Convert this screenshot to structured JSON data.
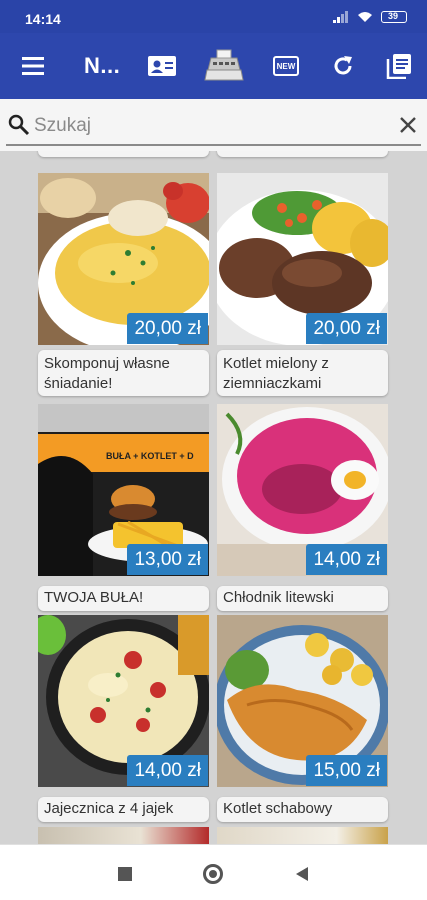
{
  "status": {
    "time": "14:14",
    "battery": "39"
  },
  "toolbar": {
    "title": "N...",
    "icons": [
      "menu-icon",
      "contact-card-icon",
      "cash-register-icon",
      "new-badge-icon",
      "refresh-icon",
      "copy-list-icon"
    ],
    "new_badge": "NEW"
  },
  "search": {
    "placeholder": "Szukaj",
    "value": ""
  },
  "products": [
    {
      "name": "Skomponuj własne śniadanie!",
      "price": "20,00 zł"
    },
    {
      "name": "Kotlet mielony z ziemniaczkami",
      "price": "20,00 zł"
    },
    {
      "name": "TWOJA BUŁA!",
      "price": "13,00 zł",
      "photo_text": "BUŁA + KOTLET + D"
    },
    {
      "name": "Chłodnik litewski",
      "price": "14,00 zł"
    },
    {
      "name": "Jajecznica z 4 jajek",
      "price": "14,00 zł"
    },
    {
      "name": "Kotlet schabowy",
      "price": "15,00 zł"
    }
  ],
  "navbar": {
    "buttons": [
      "recent-apps",
      "home",
      "back"
    ]
  },
  "colors": {
    "appbar": "#2d47ad",
    "price_badge": "#2a7ec0",
    "background": "#d3d3d3"
  }
}
